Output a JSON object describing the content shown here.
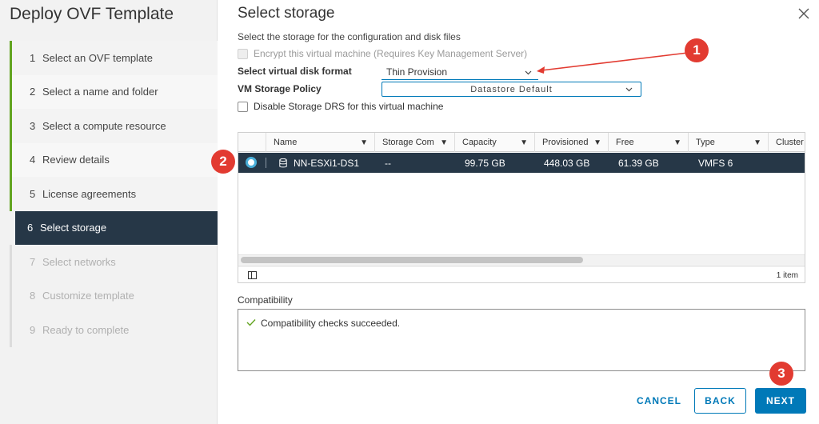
{
  "wizard": {
    "title": "Deploy OVF Template",
    "steps": [
      {
        "num": "1",
        "label": "Select an OVF template",
        "state": "done"
      },
      {
        "num": "2",
        "label": "Select a name and folder",
        "state": "done"
      },
      {
        "num": "3",
        "label": "Select a compute resource",
        "state": "done"
      },
      {
        "num": "4",
        "label": "Review details",
        "state": "done"
      },
      {
        "num": "5",
        "label": "License agreements",
        "state": "done"
      },
      {
        "num": "6",
        "label": "Select storage",
        "state": "active"
      },
      {
        "num": "7",
        "label": "Select networks",
        "state": "future"
      },
      {
        "num": "8",
        "label": "Customize template",
        "state": "future"
      },
      {
        "num": "9",
        "label": "Ready to complete",
        "state": "future"
      }
    ]
  },
  "page": {
    "title": "Select storage",
    "description": "Select the storage for the configuration and disk files",
    "close_icon": "close-icon",
    "encrypt_label": "Encrypt this virtual machine (Requires Key Management Server)",
    "disk_format_label": "Select virtual disk format",
    "disk_format_value": "Thin Provision",
    "policy_label": "VM Storage Policy",
    "policy_value": "Datastore Default",
    "drs_label": "Disable Storage DRS for this virtual machine"
  },
  "grid": {
    "columns": [
      "Name",
      "Storage Com",
      "Capacity",
      "Provisioned",
      "Free",
      "Type",
      "Cluster"
    ],
    "rows": [
      {
        "name": "NN-ESXi1-DS1",
        "storage_compat": "--",
        "capacity": "99.75 GB",
        "provisioned": "448.03 GB",
        "free": "61.39 GB",
        "type": "VMFS 6",
        "cluster": ""
      }
    ],
    "item_count": "1 item"
  },
  "compatibility": {
    "label": "Compatibility",
    "message": "Compatibility checks succeeded."
  },
  "buttons": {
    "cancel": "CANCEL",
    "back": "BACK",
    "next": "NEXT"
  },
  "callouts": [
    "1",
    "2",
    "3"
  ],
  "colors": {
    "accent": "#0079b8",
    "active_step": "#263747",
    "done_bar": "#62a420",
    "callout": "#e23b31"
  }
}
